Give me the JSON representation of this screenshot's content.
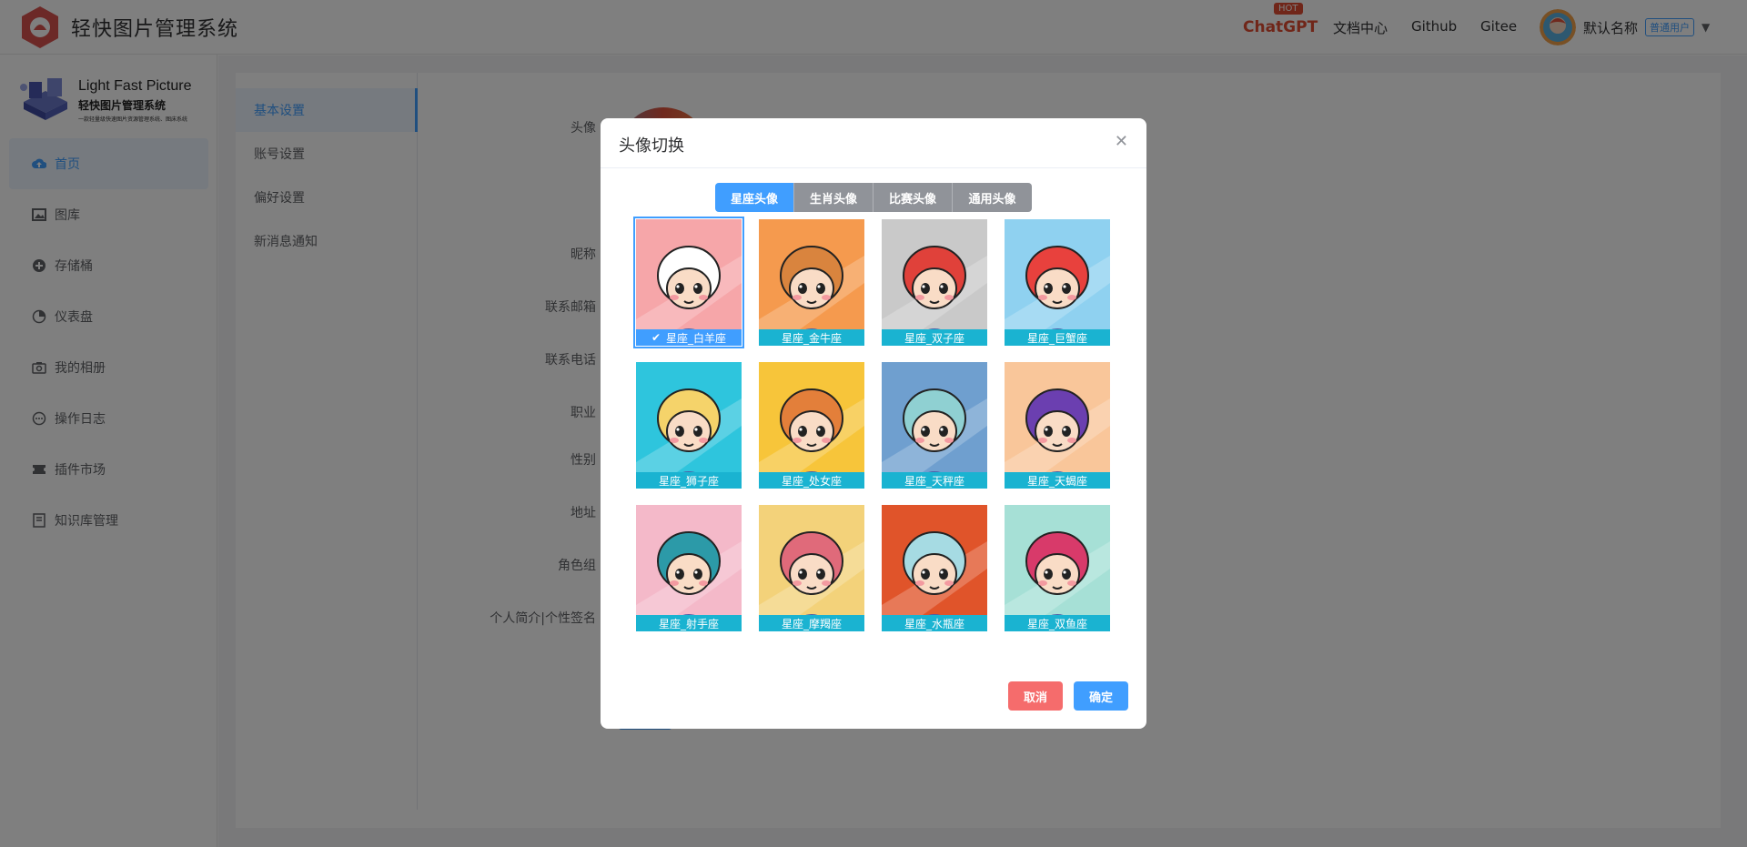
{
  "header": {
    "app_title": "轻快图片管理系统",
    "hot_badge": "HOT",
    "nav": {
      "chatgpt": "ChatGPT",
      "docs": "文档中心",
      "github": "Github",
      "gitee": "Gitee"
    },
    "user": {
      "name": "默认名称",
      "badge": "普通用户"
    }
  },
  "sidebar": {
    "logo_title": "Light Fast Picture",
    "logo_subtitle": "轻快图片管理系统",
    "logo_tagline": "一款轻量级快速图片资源管理系统、图床系统",
    "items": [
      {
        "label": "首页",
        "icon": "cloud-upload-icon"
      },
      {
        "label": "图库",
        "icon": "image-icon"
      },
      {
        "label": "存储桶",
        "icon": "bucket-icon"
      },
      {
        "label": "仪表盘",
        "icon": "pie-chart-icon"
      },
      {
        "label": "我的相册",
        "icon": "camera-icon"
      },
      {
        "label": "操作日志",
        "icon": "chat-icon"
      },
      {
        "label": "插件市场",
        "icon": "ticket-icon"
      },
      {
        "label": "知识库管理",
        "icon": "document-icon"
      }
    ]
  },
  "settings": {
    "tabs": [
      "基本设置",
      "账号设置",
      "偏好设置",
      "新消息通知"
    ],
    "fields": [
      "头像",
      "昵称",
      "联系邮箱",
      "联系电话",
      "职业",
      "性别",
      "地址",
      "角色组",
      "个人简介|个性签名"
    ]
  },
  "dialog": {
    "title": "头像切换",
    "segments": [
      "星座头像",
      "生肖头像",
      "比赛头像",
      "通用头像"
    ],
    "active_segment": 0,
    "avatars": [
      {
        "label": "星座_白羊座",
        "bg": "#f6a6a9",
        "hair": "#ffffff",
        "selected": true
      },
      {
        "label": "星座_金牛座",
        "bg": "#f59a4e",
        "hair": "#d9843e",
        "selected": false
      },
      {
        "label": "星座_双子座",
        "bg": "#c9c9c9",
        "hair": "#e0413a",
        "selected": false
      },
      {
        "label": "星座_巨蟹座",
        "bg": "#8fd1f0",
        "hair": "#e8413d",
        "selected": false
      },
      {
        "label": "星座_狮子座",
        "bg": "#2ec5dd",
        "hair": "#f5d36a",
        "selected": false
      },
      {
        "label": "星座_处女座",
        "bg": "#f7c53a",
        "hair": "#e37f3a",
        "selected": false
      },
      {
        "label": "星座_天秤座",
        "bg": "#6f9fcf",
        "hair": "#8fd0d2",
        "selected": false
      },
      {
        "label": "星座_天蝎座",
        "bg": "#f9c69a",
        "hair": "#6b3fb0",
        "selected": false
      },
      {
        "label": "星座_射手座",
        "bg": "#f4b9c9",
        "hair": "#2c9aa8",
        "selected": false
      },
      {
        "label": "星座_摩羯座",
        "bg": "#f3d27a",
        "hair": "#e06a7a",
        "selected": false
      },
      {
        "label": "星座_水瓶座",
        "bg": "#e0542a",
        "hair": "#a6dbe3",
        "selected": false
      },
      {
        "label": "星座_双鱼座",
        "bg": "#a6e0d6",
        "hair": "#d83a6a",
        "selected": false
      }
    ],
    "cancel": "取消",
    "confirm": "确定"
  },
  "colors": {
    "primary": "#409eff",
    "danger": "#f56c6c",
    "brand": "#e04d32"
  }
}
